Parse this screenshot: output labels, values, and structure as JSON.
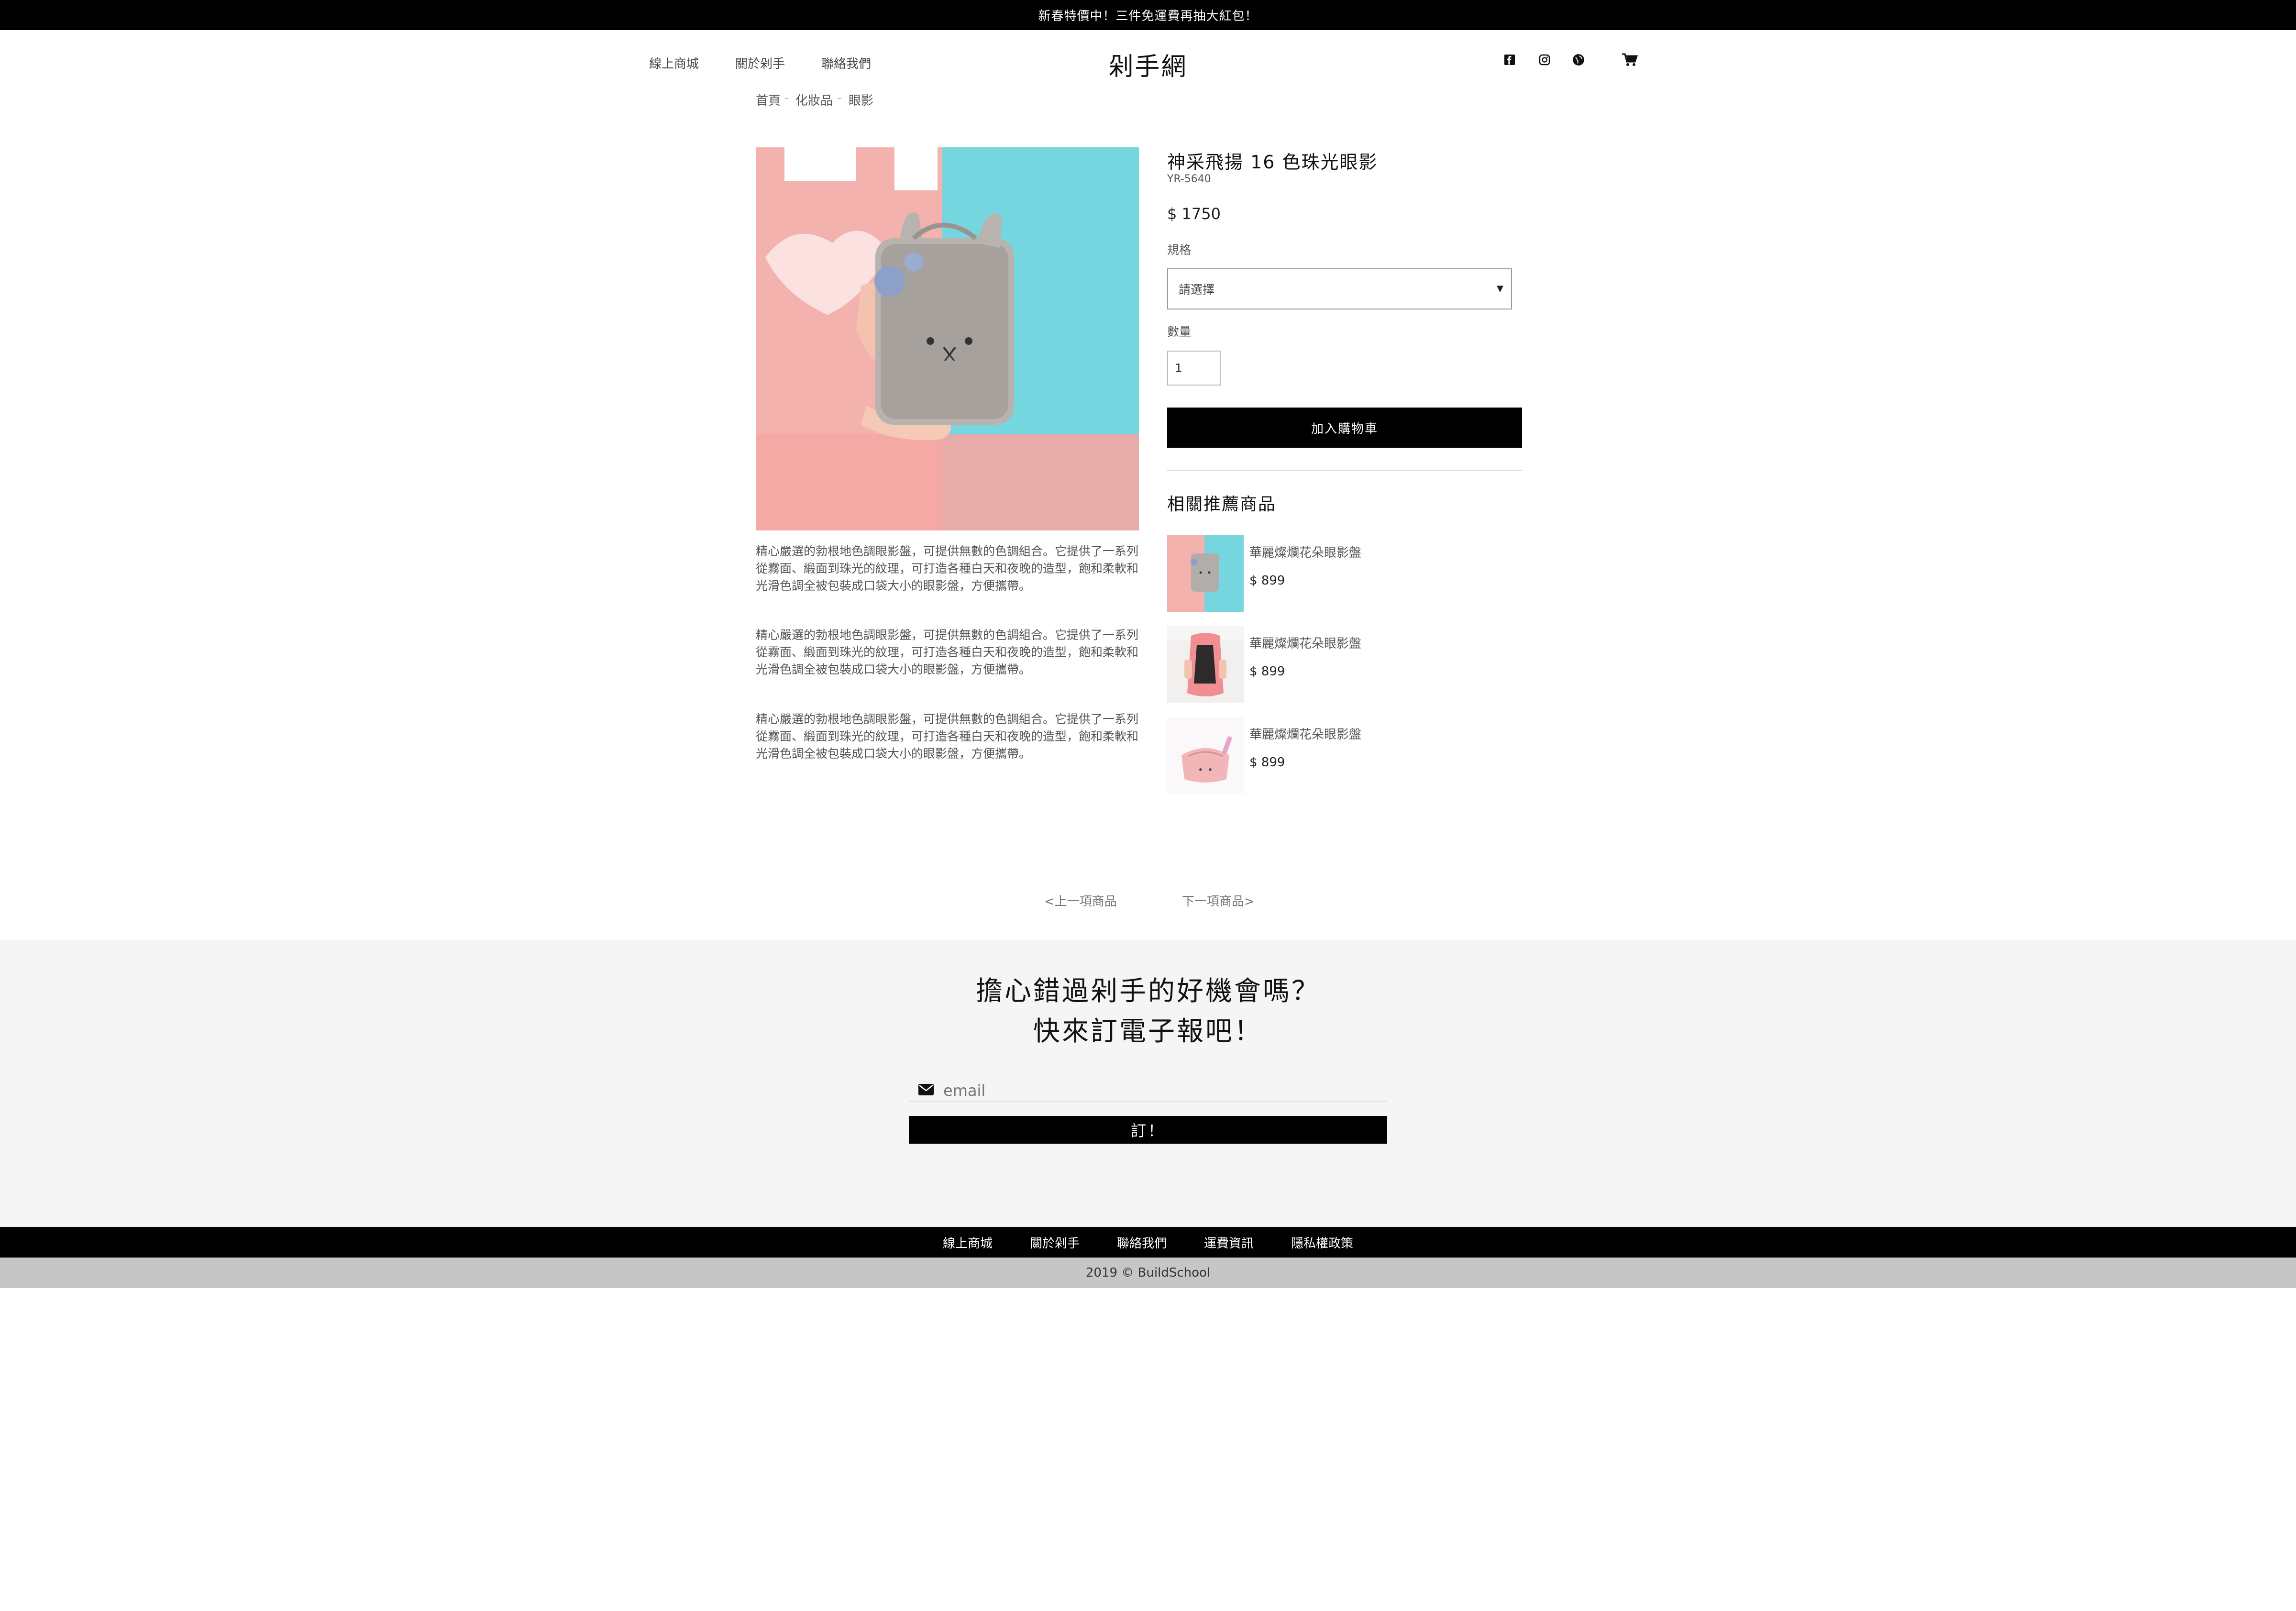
{
  "announcement": "新春特價中！三件免運費再抽大紅包！",
  "header": {
    "nav": [
      "線上商城",
      "關於剁手",
      "聯絡我們"
    ],
    "logo": "剁手網",
    "icons": [
      "facebook-icon",
      "instagram-icon",
      "globe-icon",
      "cart-icon"
    ]
  },
  "breadcrumb": [
    "首頁",
    "化妝品",
    "眼影"
  ],
  "product": {
    "title": "神采飛揚 16 色珠光眼影",
    "sku": "YR-5640",
    "price": "$ 1750",
    "spec_label": "規格",
    "spec_value": "請選擇",
    "qty_label": "數量",
    "qty_value": "1",
    "add_to_cart": "加入購物車",
    "description": [
      "精心嚴選的勃根地色調眼影盤，可提供無數的色調組合。它提供了一系列從霧面、緞面到珠光的紋理，可打造各種白天和夜晚的造型，飽和柔軟和光滑色調全被包裝成口袋大小的眼影盤，方便攜帶。",
      "精心嚴選的勃根地色調眼影盤，可提供無數的色調組合。它提供了一系列從霧面、緞面到珠光的紋理，可打造各種白天和夜晚的造型，飽和柔軟和光滑色調全被包裝成口袋大小的眼影盤，方便攜帶。",
      "精心嚴選的勃根地色調眼影盤，可提供無數的色調組合。它提供了一系列從霧面、緞面到珠光的紋理，可打造各種白天和夜晚的造型，飽和柔軟和光滑色調全被包裝成口袋大小的眼影盤，方便攜帶。"
    ]
  },
  "related": {
    "title": "相關推薦商品",
    "items": [
      {
        "name": "華麗燦爛花朵眼影盤",
        "price": "$ 899"
      },
      {
        "name": "華麗燦爛花朵眼影盤",
        "price": "$ 899"
      },
      {
        "name": "華麗燦爛花朵眼影盤",
        "price": "$ 899"
      }
    ]
  },
  "pager": {
    "prev": "<上一項商品",
    "next": "下一項商品>"
  },
  "newsletter": {
    "line1": "擔心錯過剁手的好機會嗎？",
    "line2": "快來訂電子報吧！",
    "placeholder": "email",
    "button": "訂！"
  },
  "footer": {
    "links": [
      "線上商城",
      "關於剁手",
      "聯絡我們",
      "運費資訊",
      "隱私權政策"
    ],
    "copyright": "2019 © BuildSchool"
  },
  "colors": {
    "accent": "#000000",
    "background": "#ffffff",
    "newsletter_bg": "#f5f5f6",
    "copyright_bg": "#c6c6c6"
  }
}
